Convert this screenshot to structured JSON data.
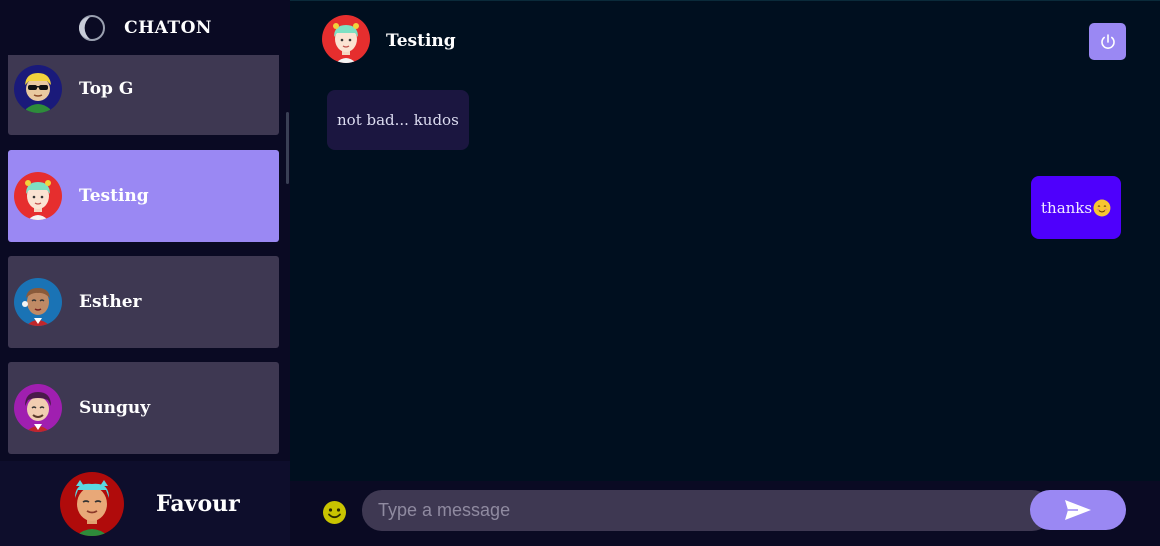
{
  "app": {
    "name": "CHATON"
  },
  "contacts": [
    {
      "name": "Top G",
      "active": false
    },
    {
      "name": "Testing",
      "active": true
    },
    {
      "name": "Esther",
      "active": false
    },
    {
      "name": "Sunguy",
      "active": false
    }
  ],
  "current_user": {
    "name": "Favour"
  },
  "chat": {
    "contact_name": "Testing",
    "messages": [
      {
        "direction": "received",
        "text": "not bad... kudos"
      },
      {
        "direction": "sent",
        "text": "thanks",
        "emoji": "smiling-face-emoji"
      }
    ]
  },
  "composer": {
    "placeholder": "Type a message"
  },
  "icons": {
    "logout": "power-icon",
    "emoji_picker": "smiley-icon",
    "send": "send-arrow-icon",
    "brand": "crescent-logo-icon"
  },
  "colors": {
    "accent": "#9a88f3",
    "sent_bubble": "#4e00fc",
    "received_bubble": "#1b1640",
    "contact_card": "#3e3852",
    "background": "#000f1f"
  }
}
